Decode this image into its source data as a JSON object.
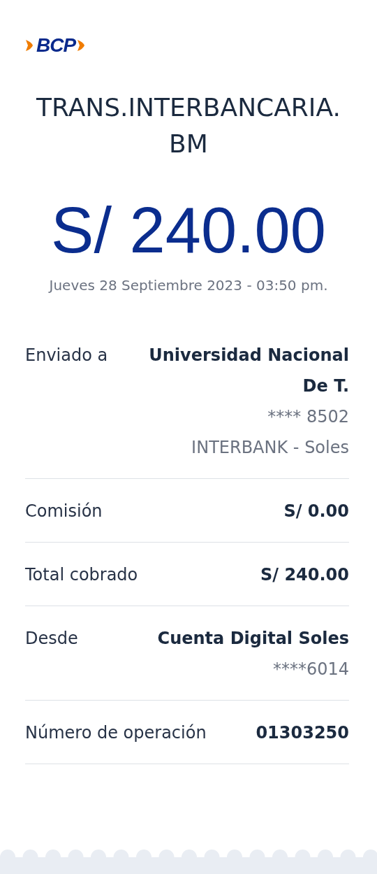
{
  "logo": {
    "text": "BCP"
  },
  "title": "TRANS.INTERBANCARIA. BM",
  "amount": "S/ 240.00",
  "datetime": "Jueves 28 Septiembre 2023 - 03:50 pm.",
  "details": [
    {
      "label": "Enviado a",
      "value": "Universidad Nacional De T.",
      "subs": [
        "**** 8502",
        "INTERBANK - Soles"
      ]
    },
    {
      "label": "Comisión",
      "value": "S/ 0.00"
    },
    {
      "label": "Total cobrado",
      "value": "S/ 240.00"
    },
    {
      "label": "Desde",
      "value": "Cuenta Digital Soles",
      "subs": [
        "****6014"
      ]
    },
    {
      "label": "Número de operación",
      "value": "01303250"
    }
  ]
}
